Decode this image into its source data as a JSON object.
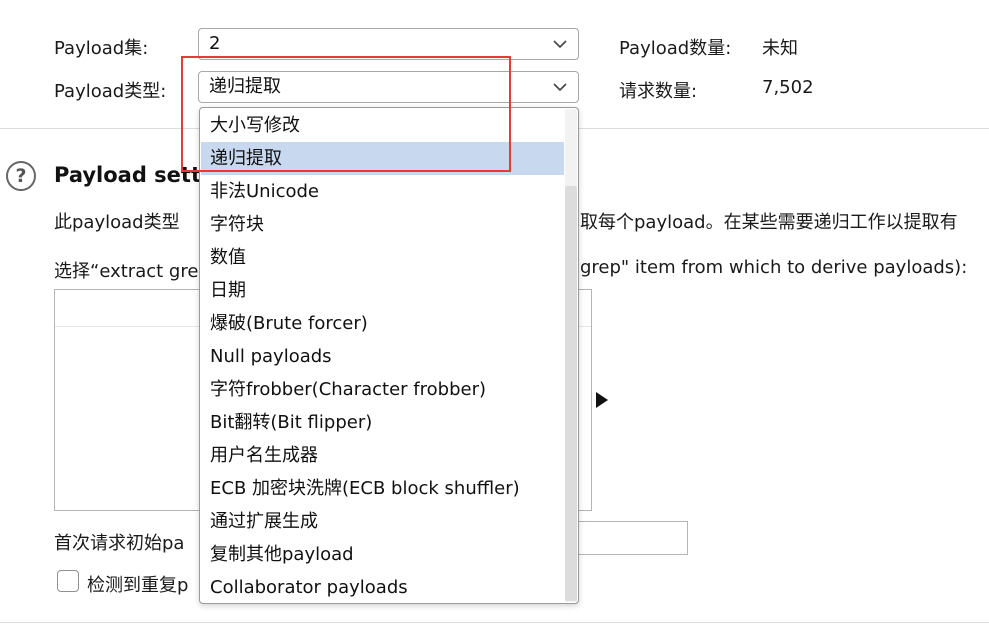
{
  "payload_set": {
    "label": "Payload集:",
    "value": "2"
  },
  "payload_type": {
    "label": "Payload类型:",
    "value": "递归提取"
  },
  "payload_count": {
    "label": "Payload数量:",
    "value": "未知"
  },
  "request_count": {
    "label": "请求数量:",
    "value": "7,502"
  },
  "section": {
    "title": "Payload sett",
    "description_left": "此payload类型",
    "description_right": "取每个payload。在某些需要递归工作以提取有",
    "select_prompt_left": "选择“extract gre",
    "select_prompt_right": "grep\" item from which to derive payloads):"
  },
  "initial_payload_label": "首次请求初始pa",
  "detect_duplicates_label": "检测到重复p",
  "dropdown": {
    "options": [
      "大小写修改",
      "递归提取",
      "非法Unicode",
      "字符块",
      "数值",
      "日期",
      "爆破(Brute forcer)",
      "Null payloads",
      "字符frobber(Character frobber)",
      "Bit翻转(Bit flipper)",
      "用户名生成器",
      "ECB 加密块洗牌(ECB block shuffler)",
      "通过扩展生成",
      "复制其他payload",
      "Collaborator payloads"
    ],
    "selected_index": 1
  },
  "colors": {
    "selected_option_bg": "#c8d8ef",
    "highlight_box": "#e53b3b"
  }
}
